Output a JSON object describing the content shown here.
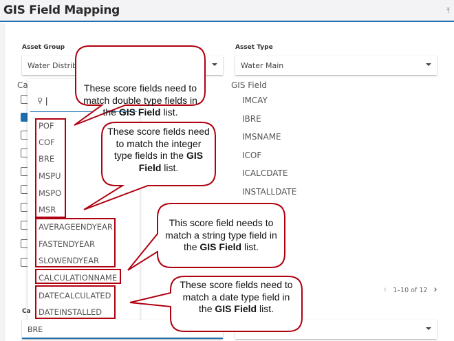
{
  "header": {
    "title": "GIS Field Mapping",
    "pin_icon": "pin-to-top-icon"
  },
  "asset_group": {
    "label": "Asset Group",
    "value": "Water Distribu"
  },
  "asset_type": {
    "label": "Asset Type",
    "value": "Water Main"
  },
  "score_section": {
    "label": "Ca"
  },
  "gis_field": {
    "label": "GIS Field",
    "items": [
      "IMCAY",
      "IBRE",
      "IMSNAME",
      "ICOF",
      "ICALCDATE",
      "INSTALLDATE"
    ]
  },
  "checkboxes": [
    false,
    true,
    false,
    false,
    false,
    false,
    false,
    false,
    false,
    false
  ],
  "popup": {
    "search_value": "|",
    "options": [
      "POF",
      "COF",
      "BRE",
      "MSPU",
      "MSPO",
      "MSR",
      "AVERAGEENDYEAR",
      "FASTENDYEAR",
      "SLOWENDYEAR",
      "CALCULATIONNAME",
      "DATECALCULATED",
      "DATEINSTALLED"
    ]
  },
  "pagination": {
    "text": "1–10 of 12"
  },
  "bottom": {
    "label": "Ca",
    "left_value": "BRE",
    "right_value": ""
  },
  "callouts": [
    {
      "pre": "These score fields need to match double type fields in the ",
      "bold": "GIS Field",
      "post": " list."
    },
    {
      "pre": "These score fields need to match the integer type fields in the ",
      "bold": "GIS Field",
      "post": " list."
    },
    {
      "pre": "This score field needs to match a string type field in the ",
      "bold": "GIS Field",
      "post": " list."
    },
    {
      "pre": "These score fields need to match a date type field in the ",
      "bold": "GIS Field",
      "post": " list."
    }
  ],
  "colors": {
    "accent": "#1f6fae",
    "callout_border": "#b00010"
  }
}
